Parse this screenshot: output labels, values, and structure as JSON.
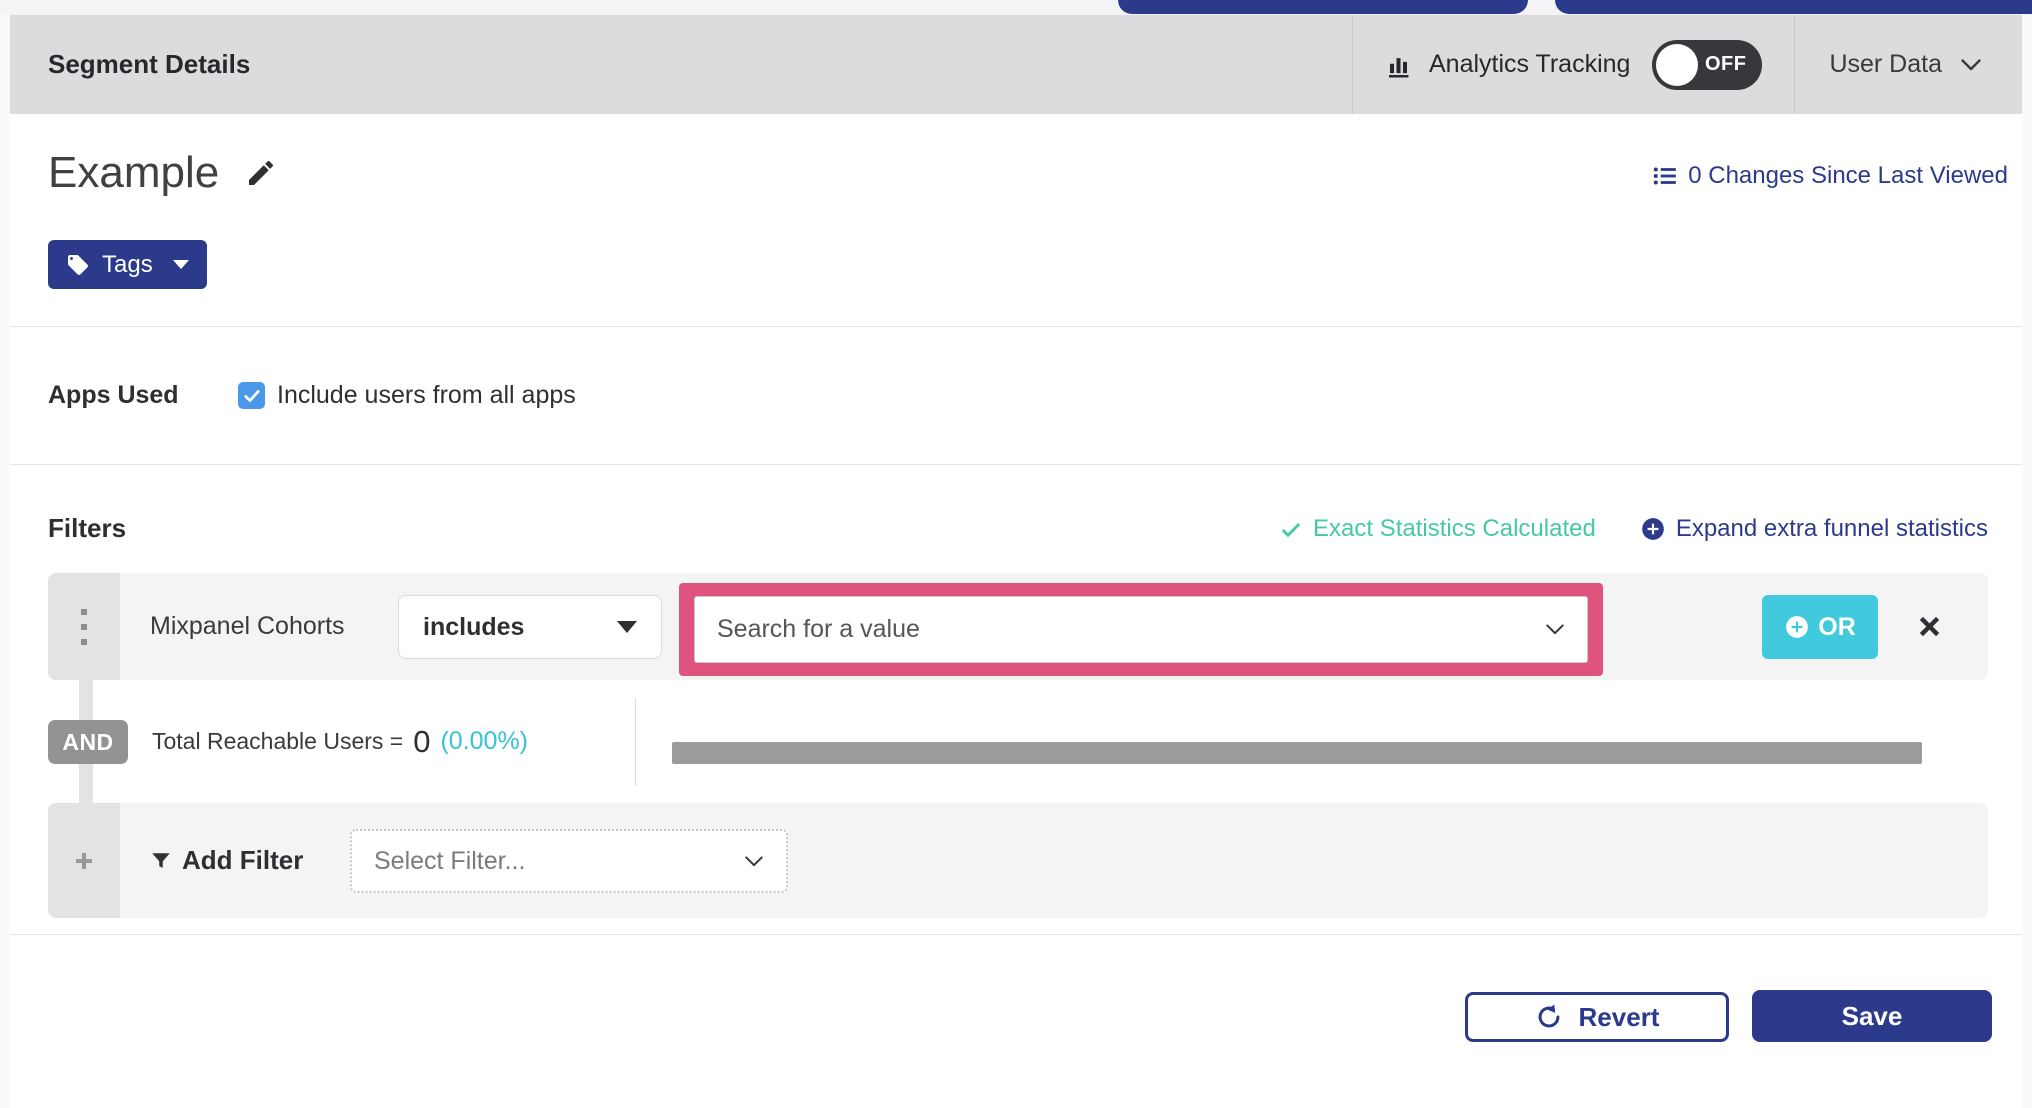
{
  "header": {
    "title": "Segment Details",
    "analytics_label": "Analytics Tracking",
    "toggle_state": "OFF",
    "user_data_label": "User Data"
  },
  "segment": {
    "name": "Example",
    "changes_link": "0 Changes Since Last Viewed",
    "tags_label": "Tags"
  },
  "apps_used": {
    "label": "Apps Used",
    "checkbox_label": "Include users from all apps",
    "checked": true
  },
  "filters": {
    "heading": "Filters",
    "status_text": "Exact Statistics Calculated",
    "expand_text": "Expand extra funnel statistics",
    "row": {
      "field": "Mixpanel Cohorts",
      "operator": "includes",
      "value_placeholder": "Search for a value",
      "or_label": "OR"
    },
    "and_label": "AND",
    "reachable_label": "Total Reachable Users =",
    "reachable_value": "0",
    "reachable_percent": "(0.00%)",
    "add_filter_label": "Add Filter",
    "select_filter_placeholder": "Select Filter..."
  },
  "footer": {
    "revert_label": "Revert",
    "save_label": "Save"
  },
  "colors": {
    "indigo": "#2c3a8c",
    "header_gray": "#dcdcdf",
    "row_gray": "#f4f4f5",
    "handle_gray": "#e3e3e6",
    "or_cyan": "#41c9dd",
    "percent_cyan": "#35c4d7",
    "status_teal": "#45c9a5",
    "highlight_pink": "#e0537e",
    "checkbox_blue": "#4a99e8",
    "progress_gray": "#9b9b9e"
  }
}
